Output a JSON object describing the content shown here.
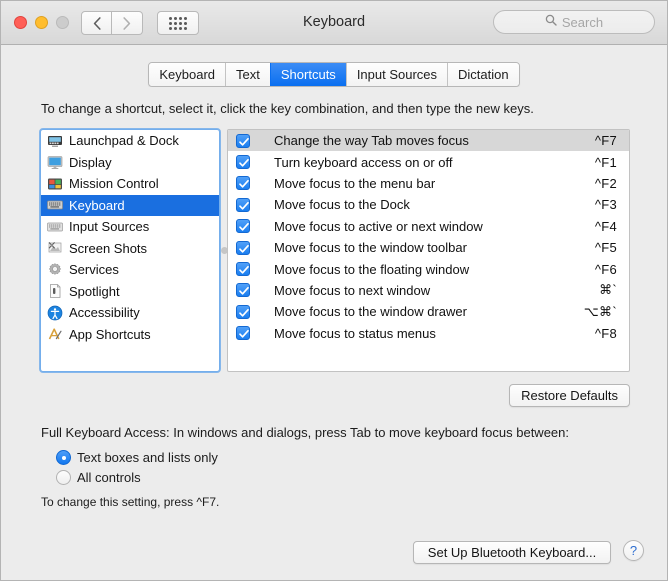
{
  "window": {
    "title": "Keyboard",
    "traffic_lights": [
      "close",
      "minimize",
      "zoom"
    ],
    "back_icon": "chevron-left-icon",
    "forward_icon": "chevron-right-icon",
    "grid_icon": "show-all-grid-icon",
    "search": {
      "icon": "search-icon",
      "placeholder": "Search",
      "value": ""
    }
  },
  "tabs": [
    {
      "label": "Keyboard",
      "active": false
    },
    {
      "label": "Text",
      "active": false
    },
    {
      "label": "Shortcuts",
      "active": true
    },
    {
      "label": "Input Sources",
      "active": false
    },
    {
      "label": "Dictation",
      "active": false
    }
  ],
  "hint": "To change a shortcut, select it, click the key combination, and then type the new keys.",
  "categories": [
    {
      "label": "Launchpad & Dock",
      "icon": "launchpad-dock-icon",
      "selected": false
    },
    {
      "label": "Display",
      "icon": "display-icon",
      "selected": false
    },
    {
      "label": "Mission Control",
      "icon": "mission-control-icon",
      "selected": false
    },
    {
      "label": "Keyboard",
      "icon": "keyboard-icon",
      "selected": true
    },
    {
      "label": "Input Sources",
      "icon": "input-sources-icon",
      "selected": false
    },
    {
      "label": "Screen Shots",
      "icon": "screen-shots-icon",
      "selected": false
    },
    {
      "label": "Services",
      "icon": "services-gear-icon",
      "selected": false
    },
    {
      "label": "Spotlight",
      "icon": "spotlight-icon",
      "selected": false
    },
    {
      "label": "Accessibility",
      "icon": "accessibility-icon",
      "selected": false
    },
    {
      "label": "App Shortcuts",
      "icon": "app-shortcuts-icon",
      "selected": false
    }
  ],
  "shortcuts": [
    {
      "name": "Change the way Tab moves focus",
      "key": "^F7",
      "checked": true,
      "selected": true
    },
    {
      "name": "Turn keyboard access on or off",
      "key": "^F1",
      "checked": true,
      "selected": false
    },
    {
      "name": "Move focus to the menu bar",
      "key": "^F2",
      "checked": true,
      "selected": false
    },
    {
      "name": "Move focus to the Dock",
      "key": "^F3",
      "checked": true,
      "selected": false
    },
    {
      "name": "Move focus to active or next window",
      "key": "^F4",
      "checked": true,
      "selected": false
    },
    {
      "name": "Move focus to the window toolbar",
      "key": "^F5",
      "checked": true,
      "selected": false
    },
    {
      "name": "Move focus to the floating window",
      "key": "^F6",
      "checked": true,
      "selected": false
    },
    {
      "name": "Move focus to next window",
      "key": "⌘`",
      "checked": true,
      "selected": false
    },
    {
      "name": "Move focus to the window drawer",
      "key": "⌥⌘`",
      "checked": true,
      "selected": false
    },
    {
      "name": "Move focus to status menus",
      "key": "^F8",
      "checked": true,
      "selected": false
    }
  ],
  "restore_defaults_label": "Restore Defaults",
  "full_keyboard_access": {
    "label": "Full Keyboard Access: In windows and dialogs, press Tab to move keyboard focus between:",
    "options": [
      {
        "label": "Text boxes and lists only",
        "selected": true
      },
      {
        "label": "All controls",
        "selected": false
      }
    ],
    "note": "To change this setting, press ^F7."
  },
  "bottom_bar": {
    "bluetooth_label": "Set Up Bluetooth Keyboard...",
    "help_label": "?"
  },
  "colors": {
    "accent_blue": "#1a6fe0",
    "tab_active": "#0a6ff0",
    "selection_gray": "#d7d7d7",
    "window_bg": "#ececec",
    "focus_ring": "#64a5eb"
  }
}
